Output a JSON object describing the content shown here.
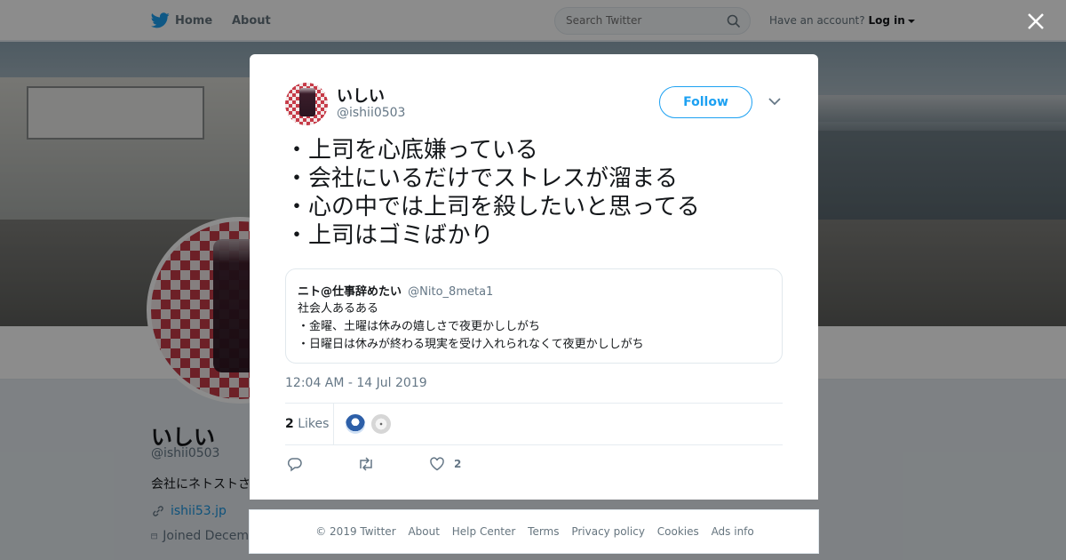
{
  "topbar": {
    "home_label": "Home",
    "about_label": "About",
    "search_placeholder": "Search Twitter",
    "account_prompt": "Have an account?",
    "login_label": "Log in"
  },
  "profile": {
    "name": "いしい",
    "handle": "@ishii0503",
    "bio": "会社にネトストさ",
    "link": "ishii53.jp",
    "joined": "Joined Decem"
  },
  "tweet": {
    "author_name": "いしい",
    "author_handle": "@ishii0503",
    "follow_label": "Follow",
    "lines": [
      "・上司を心底嫌っている",
      "・会社にいるだけでストレスが溜まる",
      "・心の中では上司を殺したいと思ってる",
      "・上司はゴミばかり"
    ],
    "quote": {
      "name": "ニト@仕事辞めたい",
      "handle": "@Nito_8meta1",
      "lines": [
        "社会人あるある",
        "・金曜、土曜は休みの嬉しさで夜更かししがち",
        "・日曜日は休みが終わる現実を受け入れられなくて夜更かししがち"
      ]
    },
    "timestamp": "12:04 AM - 14 Jul 2019",
    "likes_count": "2",
    "likes_label": "Likes",
    "like_action_count": "2"
  },
  "footer": {
    "copyright": "© 2019 Twitter",
    "links": [
      "About",
      "Help Center",
      "Terms",
      "Privacy policy",
      "Cookies",
      "Ads info"
    ]
  },
  "colors": {
    "accent": "#1da1f2",
    "link": "#1b95e0",
    "muted": "#657786",
    "text": "#14171a"
  }
}
